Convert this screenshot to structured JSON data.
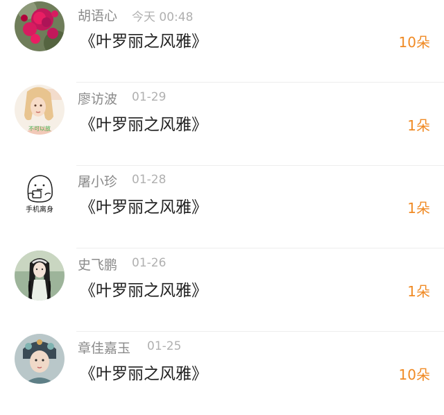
{
  "colors": {
    "name": "#8a8a8a",
    "date": "#b0b0b0",
    "title": "#222222",
    "count": "#f08a24",
    "divider": "#ededed"
  },
  "items": [
    {
      "name": "胡语心",
      "date": "今天 00:48",
      "title": "《叶罗丽之风雅》",
      "count": "10朵",
      "avatar": "rose-avatar"
    },
    {
      "name": "廖访波",
      "date": "01-29",
      "title": "《叶罗丽之风雅》",
      "count": "1朵",
      "avatar": "blonde-girl-avatar",
      "avatar_caption": "不可以放"
    },
    {
      "name": "屠小珍",
      "date": "01-28",
      "title": "《叶罗丽之风雅》",
      "count": "1朵",
      "avatar": "sketch-meme-avatar",
      "avatar_caption": "手机离身"
    },
    {
      "name": "史飞鹏",
      "date": "01-26",
      "title": "《叶罗丽之风雅》",
      "count": "1朵",
      "avatar": "braided-girl-avatar"
    },
    {
      "name": "章佳嘉玉",
      "date": "01-25",
      "title": "《叶罗丽之风雅》",
      "count": "10朵",
      "avatar": "costume-girl-avatar"
    }
  ]
}
